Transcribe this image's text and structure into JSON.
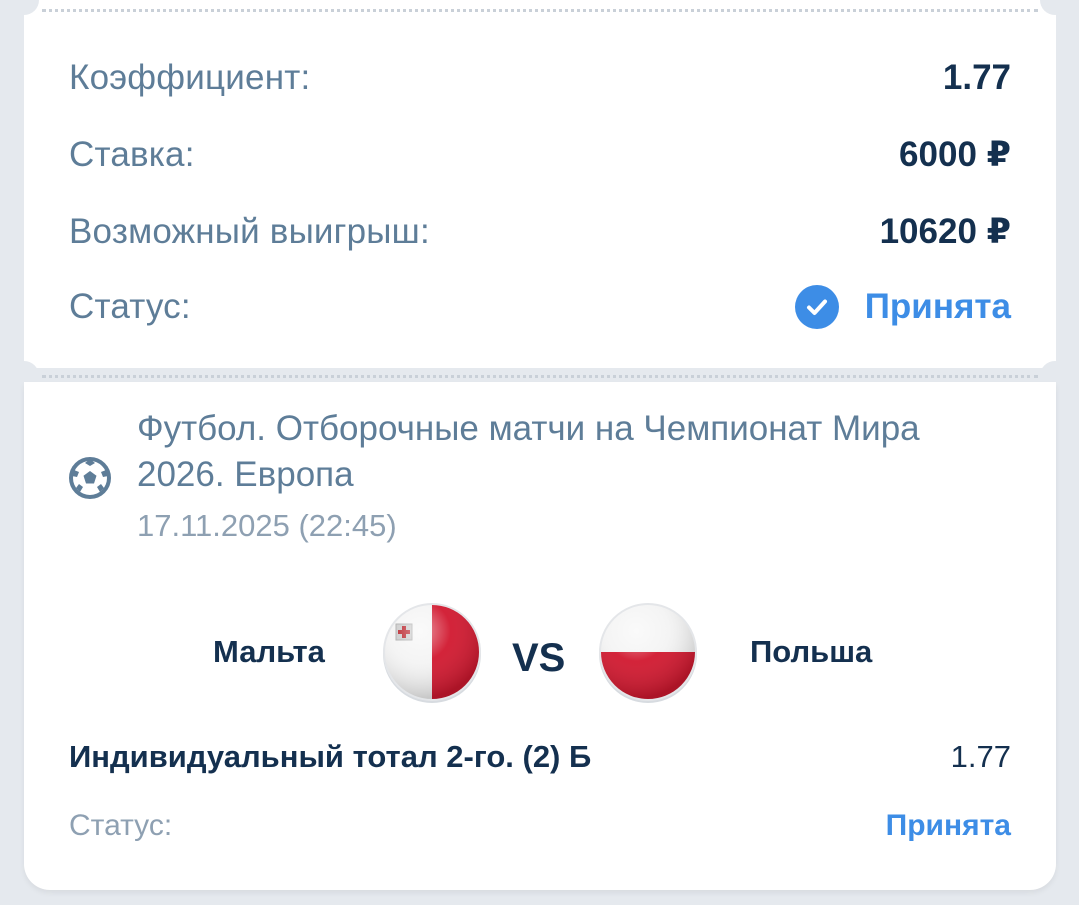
{
  "summary": {
    "odds_label": "Коэффициент:",
    "odds_value": "1.77",
    "stake_label": "Ставка:",
    "stake_value": "6000 ₽",
    "payout_label": "Возможный выигрыш:",
    "payout_value": "10620 ₽",
    "status_label": "Статус:",
    "status_value": "Принята",
    "status_icon": "check-circle-icon"
  },
  "event": {
    "sport_icon": "soccer-ball-icon",
    "title": "Футбол. Отборочные матчи на Чемпионат Мира 2026. Европа",
    "date": "17.11.2025 (22:45)",
    "home_team": "Мальта",
    "away_team": "Польша",
    "vs_label": "VS"
  },
  "selection": {
    "name": "Индивидуальный тотал 2-го. (2) Б",
    "odds": "1.77",
    "status_label": "Статус:",
    "status_value": "Принята"
  },
  "colors": {
    "background": "#e5e9ee",
    "card": "#ffffff",
    "label": "#5e7d98",
    "value": "#14304f",
    "accent": "#3d8de6",
    "muted": "#8ea0b2"
  }
}
